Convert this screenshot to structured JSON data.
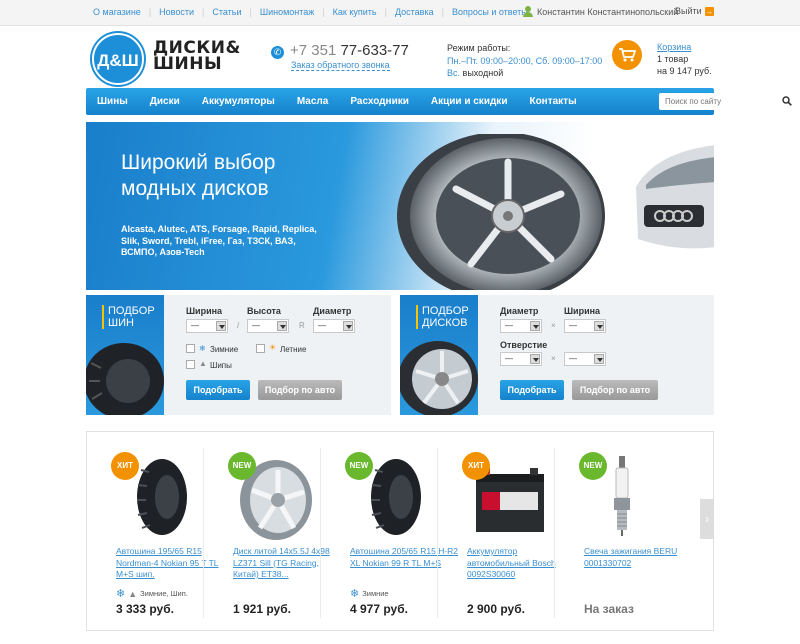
{
  "topbar": {
    "links": [
      "О магазине",
      "Новости",
      "Статьи",
      "Шиномонтаж",
      "Как купить",
      "Доставка",
      "Вопросы и ответы"
    ],
    "user": "Константин Константинопольский",
    "logout": "Выйти"
  },
  "header": {
    "logo": "Д&Ш",
    "brand_line1": "ДИСКИ&",
    "brand_line2": "ШИНЫ",
    "phone_code": "+7 351",
    "phone_number": "77-633-77",
    "callback": "Заказ обратного звонка",
    "hours_title": "Режим работы:",
    "hours_weekdays": "Пн.–Пт. 09:00–20:00, Сб. 09:00–17:00",
    "hours_sunday_day": "Вс.",
    "hours_sunday": "выходной",
    "cart_link": "Корзина",
    "cart_count": "1 товар",
    "cart_total": "на 9 147 руб."
  },
  "nav": {
    "items": [
      "Шины",
      "Диски",
      "Аккумуляторы",
      "Масла",
      "Расходники",
      "Акции и скидки",
      "Контакты"
    ],
    "search_placeholder": "Поиск по сайту"
  },
  "banner": {
    "title": "Широкий выбор модных дисков",
    "text": "Alcasta, Alutec, ATS, Forsage, Rapid, Replica, Slik, Sword, Trebl, iFree, Газ, ТЗСК, ВАЗ, ВСМПО, Азов-Tech",
    "slides": 3,
    "active_slide": 2
  },
  "filter_tires": {
    "title": "ПОДБОР ШИН",
    "width_label": "Ширина",
    "height_label": "Высота",
    "diameter_label": "Диаметр",
    "width_value": "—",
    "height_value": "—",
    "diameter_value": "—",
    "sep1": "/",
    "sep2": "R",
    "winter": "Зимние",
    "summer": "Летние",
    "studs": "Шипы",
    "submit": "Подобрать",
    "by_car": "Подбор по авто"
  },
  "filter_disks": {
    "title": "ПОДБОР ДИСКОВ",
    "diameter_label": "Диаметр",
    "width_label": "Ширина",
    "bolt_label": "Отверстие",
    "diameter_value": "—",
    "width_value": "—",
    "bolt_value1": "—",
    "bolt_value2": "—",
    "sep": "×",
    "submit": "Подобрать",
    "by_car": "Подбор по авто"
  },
  "products": [
    {
      "badge": "ХИТ",
      "name": "Автошина 195/65 R15 Nordman-4 Nokian 95 T TL M+S шип.",
      "props": "Зимние, Шип.",
      "price": "3 333 руб."
    },
    {
      "badge": "NEW",
      "name": "Диск литой 14x5.5J 4x98 LZ371 Sill (TG Racing, Китай) ET38...",
      "props": "",
      "price": "1 921 руб."
    },
    {
      "badge": "NEW",
      "name": "Автошина 205/65 R15 H-R2 XL Nokian 99 R TL M+S",
      "props": "Зимние",
      "price": "4 977 руб."
    },
    {
      "badge": "ХИТ",
      "name": "Аккумулятор автомобильный Bosch 0092S30060",
      "props": "",
      "price": "2 900 руб."
    },
    {
      "badge": "NEW",
      "name": "Свеча зажигания BERU 0001330702",
      "props": "",
      "price": "На заказ"
    }
  ],
  "colors": {
    "brand_blue": "#1d8fd8",
    "accent_orange": "#f39200",
    "new_green": "#6ab82e"
  }
}
